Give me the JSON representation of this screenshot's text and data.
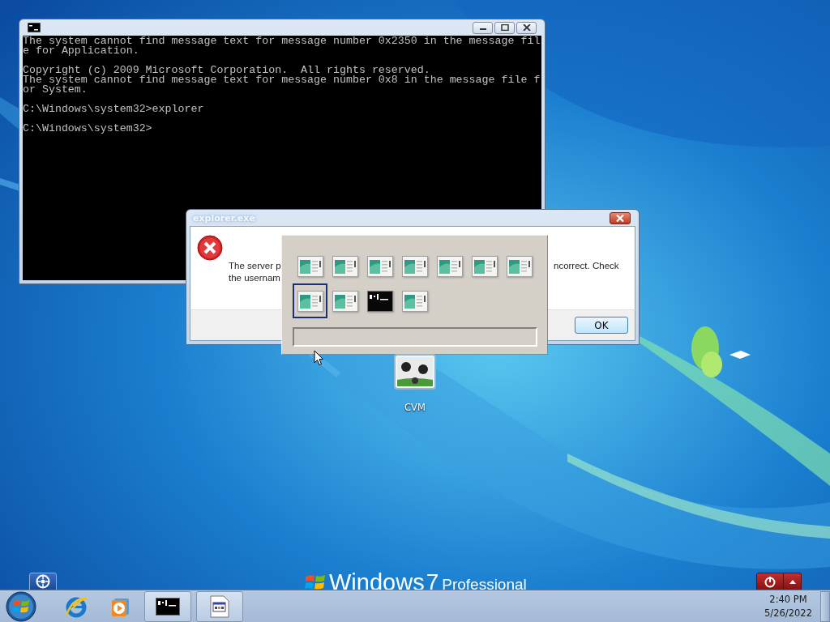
{
  "desktop": {
    "icons": [
      {
        "label": "CVM",
        "kind": "ball"
      }
    ],
    "logo": {
      "brand": "Windows",
      "version": "7",
      "edition": "Professional"
    }
  },
  "console_window": {
    "blocks": [
      [
        "The system cannot find message text for message number 0x2350 in the message fil",
        "e for Application."
      ],
      [
        "Copyright (c) 2009 Microsoft Corporation.  All rights reserved.",
        "The system cannot find message text for message number 0x8 in the message file f",
        "or System."
      ],
      [
        "C:\\Windows\\system32>explorer"
      ],
      [
        "C:\\Windows\\system32>"
      ]
    ]
  },
  "dialog": {
    "title": "explorer.exe",
    "message_left": [
      "The server p",
      "the usernam"
    ],
    "message_right": [
      "ncorrect. Check"
    ],
    "buttons": [
      "OK"
    ]
  },
  "switcher": {
    "items": [
      {
        "kind": "window",
        "selected": false
      },
      {
        "kind": "window",
        "selected": false
      },
      {
        "kind": "window",
        "selected": false
      },
      {
        "kind": "window",
        "selected": false
      },
      {
        "kind": "window",
        "selected": false
      },
      {
        "kind": "window",
        "selected": false
      },
      {
        "kind": "window",
        "selected": false
      },
      {
        "kind": "window",
        "selected": true
      },
      {
        "kind": "window",
        "selected": false
      },
      {
        "kind": "console",
        "selected": false
      },
      {
        "kind": "window",
        "selected": false
      }
    ]
  },
  "taskbar": {
    "pinned": [
      {
        "kind": "start"
      },
      {
        "kind": "browser"
      },
      {
        "kind": "media"
      }
    ],
    "tasks": [
      {
        "kind": "console"
      },
      {
        "kind": "app"
      }
    ],
    "clock": {
      "time": "2:40 PM",
      "date": "5/26/2022"
    }
  }
}
